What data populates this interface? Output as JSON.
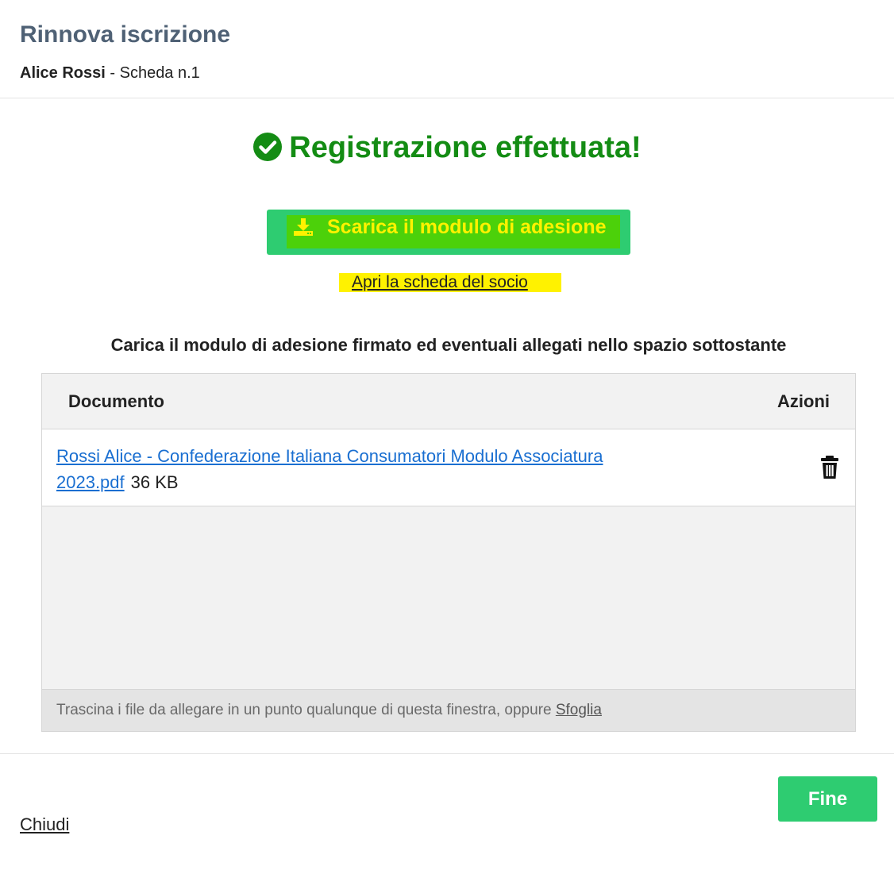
{
  "header": {
    "title": "Rinnova iscrizione",
    "member_name": "Alice Rossi",
    "card_label": " - Scheda n.1"
  },
  "success": {
    "message": "Registrazione effettuata!",
    "icon": "check-circle-icon",
    "color": "#148c14"
  },
  "actions": {
    "download_label": "Scarica il modulo di adesione",
    "download_icon": "download-icon",
    "open_member_label": "Apri la scheda del socio"
  },
  "upload": {
    "instructions": "Carica il modulo di adesione firmato ed eventuali allegati nello spazio sottostante",
    "columns": {
      "document": "Documento",
      "actions": "Azioni"
    },
    "files": [
      {
        "name": "Rossi Alice - Confederazione Italiana Consumatori Modulo Associatura 2023.pdf",
        "size": "36 KB",
        "action_icon": "trash-icon"
      }
    ],
    "dropzone_hint": "Trascina i file da allegare in un punto qualunque di questa finestra, oppure ",
    "browse_label": "Sfoglia"
  },
  "footer": {
    "close_label": "Chiudi",
    "done_label": "Fine"
  },
  "colors": {
    "primary_green": "#2ecc71",
    "highlight_yellow": "#fff200",
    "title_slate": "#4f6175",
    "link_blue": "#1a6fd1"
  }
}
